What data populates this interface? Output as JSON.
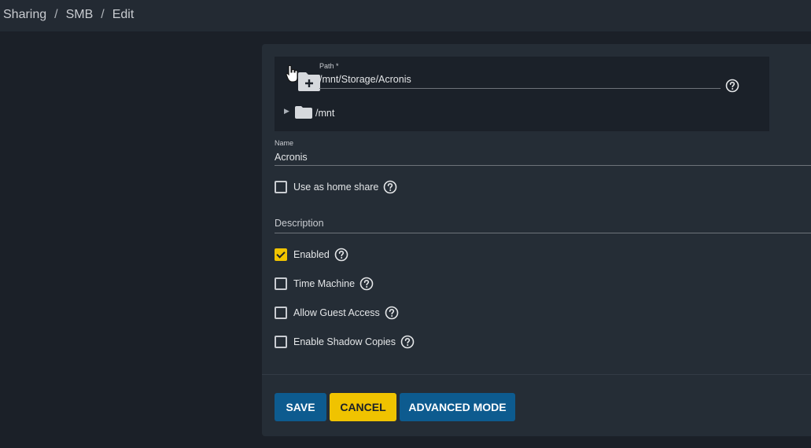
{
  "breadcrumb": [
    "Sharing",
    "SMB",
    "Edit"
  ],
  "path": {
    "label": "Path *",
    "value": "/mnt/Storage/Acronis",
    "tree_root": "/mnt"
  },
  "name": {
    "label": "Name",
    "value": "Acronis"
  },
  "home_share": {
    "label": "Use as home share",
    "checked": false
  },
  "description": {
    "label": "Description",
    "value": ""
  },
  "options": [
    {
      "label": "Enabled",
      "checked": true
    },
    {
      "label": "Time Machine",
      "checked": false
    },
    {
      "label": "Allow Guest Access",
      "checked": false
    },
    {
      "label": "Enable Shadow Copies",
      "checked": false
    }
  ],
  "buttons": {
    "save": "SAVE",
    "cancel": "CANCEL",
    "advanced": "ADVANCED MODE"
  },
  "colors": {
    "accent": "#f0c300",
    "primary": "#0d5b8f",
    "background": "#1b2028",
    "card": "#252d36"
  }
}
